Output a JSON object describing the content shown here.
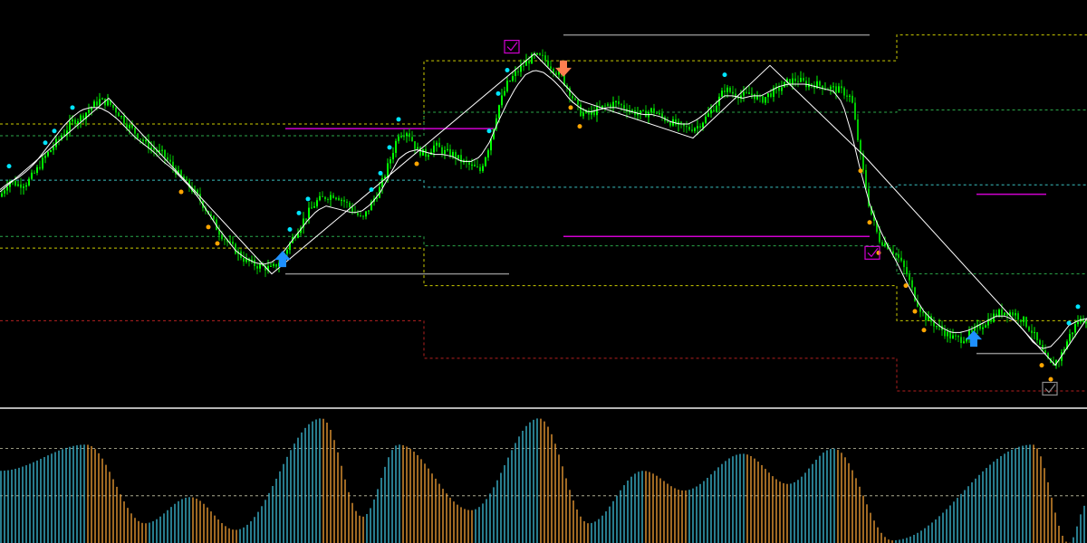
{
  "chart_data": {
    "type": "candlestick",
    "panels": [
      {
        "name": "",
        "x": [
          0,
          10,
          20,
          30,
          40,
          50,
          60,
          70,
          80,
          90,
          100,
          110,
          120,
          130,
          140,
          150,
          160,
          170,
          180,
          190,
          200,
          210,
          220,
          230,
          240,
          250,
          260,
          270,
          280,
          290,
          300,
          310,
          320,
          330,
          340,
          350,
          360,
          370,
          380,
          390,
          400,
          410,
          420,
          430,
          440,
          450,
          460,
          470,
          480,
          490,
          500,
          510,
          520,
          530,
          540,
          550,
          560,
          570,
          580,
          590,
          600,
          610,
          620,
          630,
          640,
          650,
          660,
          670,
          680,
          690,
          700,
          710,
          720,
          730,
          740,
          750,
          760,
          770,
          780,
          790,
          800,
          810,
          820,
          830,
          840,
          850,
          860,
          870,
          880,
          890,
          900,
          910,
          920,
          930,
          940,
          950,
          960,
          970,
          980,
          990,
          1000,
          1010,
          1020,
          1030,
          1040,
          1050,
          1060,
          1070,
          1080,
          1090,
          1100,
          1110,
          1120,
          1130,
          1140,
          1150,
          1160,
          1170,
          1180,
          1190,
          1200
        ],
        "close": [
          0.33,
          0.4,
          0.38,
          0.39,
          0.44,
          0.5,
          0.55,
          0.6,
          0.65,
          0.67,
          0.71,
          0.74,
          0.73,
          0.69,
          0.64,
          0.6,
          0.56,
          0.53,
          0.51,
          0.46,
          0.41,
          0.37,
          0.32,
          0.26,
          0.19,
          0.14,
          0.1,
          0.06,
          0.04,
          0.03,
          0.02,
          0.06,
          0.13,
          0.2,
          0.26,
          0.31,
          0.33,
          0.34,
          0.31,
          0.27,
          0.23,
          0.3,
          0.37,
          0.48,
          0.6,
          0.61,
          0.53,
          0.51,
          0.55,
          0.52,
          0.51,
          0.48,
          0.46,
          0.44,
          0.55,
          0.71,
          0.81,
          0.86,
          0.9,
          0.93,
          0.92,
          0.88,
          0.84,
          0.77,
          0.69,
          0.68,
          0.7,
          0.72,
          0.73,
          0.71,
          0.69,
          0.68,
          0.7,
          0.67,
          0.65,
          0.63,
          0.62,
          0.63,
          0.67,
          0.72,
          0.79,
          0.77,
          0.76,
          0.77,
          0.74,
          0.77,
          0.79,
          0.82,
          0.83,
          0.81,
          0.81,
          0.8,
          0.79,
          0.78,
          0.75,
          0.5,
          0.28,
          0.15,
          0.12,
          0.08,
          0.01,
          -0.1,
          -0.18,
          -0.21,
          -0.24,
          -0.27,
          -0.28,
          -0.26,
          -0.23,
          -0.2,
          -0.17,
          -0.16,
          -0.17,
          -0.2,
          -0.25,
          -0.33,
          -0.39,
          -0.36,
          -0.27,
          -0.2,
          -0.19
        ],
        "ma": [
          0.36,
          0.39,
          0.41,
          0.44,
          0.48,
          0.53,
          0.58,
          0.63,
          0.67,
          0.7,
          0.71,
          0.71,
          0.69,
          0.66,
          0.62,
          0.58,
          0.55,
          0.52,
          0.48,
          0.45,
          0.41,
          0.37,
          0.32,
          0.26,
          0.2,
          0.15,
          0.1,
          0.07,
          0.05,
          0.04,
          0.05,
          0.08,
          0.13,
          0.18,
          0.23,
          0.27,
          0.29,
          0.28,
          0.27,
          0.26,
          0.27,
          0.3,
          0.35,
          0.42,
          0.49,
          0.52,
          0.53,
          0.52,
          0.51,
          0.51,
          0.5,
          0.48,
          0.48,
          0.5,
          0.56,
          0.65,
          0.73,
          0.8,
          0.85,
          0.87,
          0.86,
          0.83,
          0.79,
          0.74,
          0.71,
          0.69,
          0.7,
          0.71,
          0.71,
          0.7,
          0.69,
          0.68,
          0.68,
          0.67,
          0.65,
          0.64,
          0.64,
          0.66,
          0.69,
          0.73,
          0.76,
          0.76,
          0.75,
          0.76,
          0.76,
          0.78,
          0.8,
          0.81,
          0.81,
          0.81,
          0.8,
          0.79,
          0.78,
          0.73,
          0.6,
          0.44,
          0.3,
          0.2,
          0.12,
          0.05,
          -0.03,
          -0.1,
          -0.16,
          -0.2,
          -0.23,
          -0.25,
          -0.25,
          -0.24,
          -0.22,
          -0.2,
          -0.18,
          -0.18,
          -0.2,
          -0.24,
          -0.29,
          -0.32,
          -0.31,
          -0.27,
          -0.22,
          -0.2,
          -0.19
        ],
        "zigzag": [
          {
            "x": 0,
            "y": 0.35
          },
          {
            "x": 120,
            "y": 0.75
          },
          {
            "x": 300,
            "y": 0.0
          },
          {
            "x": 590,
            "y": 0.94
          },
          {
            "x": 640,
            "y": 0.74
          },
          {
            "x": 765,
            "y": 0.58
          },
          {
            "x": 850,
            "y": 0.89
          },
          {
            "x": 955,
            "y": 0.5
          },
          {
            "x": 1165,
            "y": -0.39
          },
          {
            "x": 1200,
            "y": -0.19
          }
        ],
        "signals_buy": [
          {
            "x": 312,
            "y": 0.06
          },
          {
            "x": 1075,
            "y": -0.28
          }
        ],
        "signals_sell": [
          {
            "x": 622,
            "y": 0.88
          }
        ],
        "levels": [
          {
            "y": 0.62,
            "x0": 315,
            "x1": 545,
            "style": "solid",
            "color": "#d000d0"
          },
          {
            "y": 0.16,
            "x0": 622,
            "x1": 960,
            "style": "solid",
            "color": "#d000d0"
          },
          {
            "y": 0.34,
            "x0": 1078,
            "x1": 1155,
            "style": "solid",
            "color": "#d000d0"
          },
          {
            "y": 1.02,
            "x0": 622,
            "x1": 960,
            "style": "solid",
            "color": "#8c8c8c"
          },
          {
            "y": 0.0,
            "x0": 315,
            "x1": 562,
            "style": "solid",
            "color": "#8c8c8c"
          },
          {
            "y": -0.34,
            "x0": 1078,
            "x1": 1155,
            "style": "solid",
            "color": "#8c8c8c"
          }
        ],
        "channels": [
          {
            "color": "#cccc00",
            "steps": [
              {
                "x0": 0,
                "x1": 468,
                "y": 0.11
              },
              {
                "x0": 468,
                "x1": 990,
                "y": -0.05
              },
              {
                "x0": 990,
                "x1": 1200,
                "y": -0.2
              }
            ]
          },
          {
            "color": "#cccc00",
            "steps": [
              {
                "x0": 0,
                "x1": 468,
                "y": 0.64
              },
              {
                "x0": 468,
                "x1": 990,
                "y": 0.91
              },
              {
                "x0": 990,
                "x1": 1200,
                "y": 1.02
              }
            ]
          },
          {
            "color": "#2ba84a",
            "steps": [
              {
                "x0": 0,
                "x1": 468,
                "y": 0.59
              },
              {
                "x0": 468,
                "x1": 990,
                "y": 0.69
              },
              {
                "x0": 990,
                "x1": 1200,
                "y": 0.7
              }
            ]
          },
          {
            "color": "#2ba84a",
            "steps": [
              {
                "x0": 0,
                "x1": 468,
                "y": 0.16
              },
              {
                "x0": 468,
                "x1": 990,
                "y": 0.12
              },
              {
                "x0": 990,
                "x1": 1200,
                "y": 0.0
              }
            ]
          },
          {
            "color": "#3ac0c0",
            "steps": [
              {
                "x0": 0,
                "x1": 468,
                "y": 0.4
              },
              {
                "x0": 468,
                "x1": 990,
                "y": 0.37
              },
              {
                "x0": 990,
                "x1": 1200,
                "y": 0.38
              }
            ]
          },
          {
            "color": "#b52020",
            "steps": [
              {
                "x0": 0,
                "x1": 468,
                "y": -0.2
              },
              {
                "x0": 468,
                "x1": 990,
                "y": -0.36
              },
              {
                "x0": 990,
                "x1": 1200,
                "y": -0.5
              }
            ]
          }
        ],
        "ylim": [
          -0.55,
          1.15
        ]
      },
      {
        "name": "",
        "type": "histogram",
        "ylim": [
          0,
          1
        ],
        "levels": [
          0.72,
          0.36
        ],
        "colors": {
          "rising": "#3ab0c8",
          "falling": "#e39632"
        }
      }
    ]
  },
  "colors": {
    "background": "#000000",
    "bull_candle": "#00ff00",
    "ma_line": "#ffffff",
    "zigzag_line": "#ffffff",
    "dot_high": "#00e5ff",
    "dot_low": "#ffa500",
    "buy_arrow": "#1e90ff",
    "sell_arrow": "#ff7f50",
    "separator": "#b4b4b4",
    "hist_level": "#c8c8aa"
  },
  "icons": {
    "buy_signal": "up-arrow-icon",
    "sell_signal": "down-arrow-icon",
    "check": "checkbox-icon"
  }
}
